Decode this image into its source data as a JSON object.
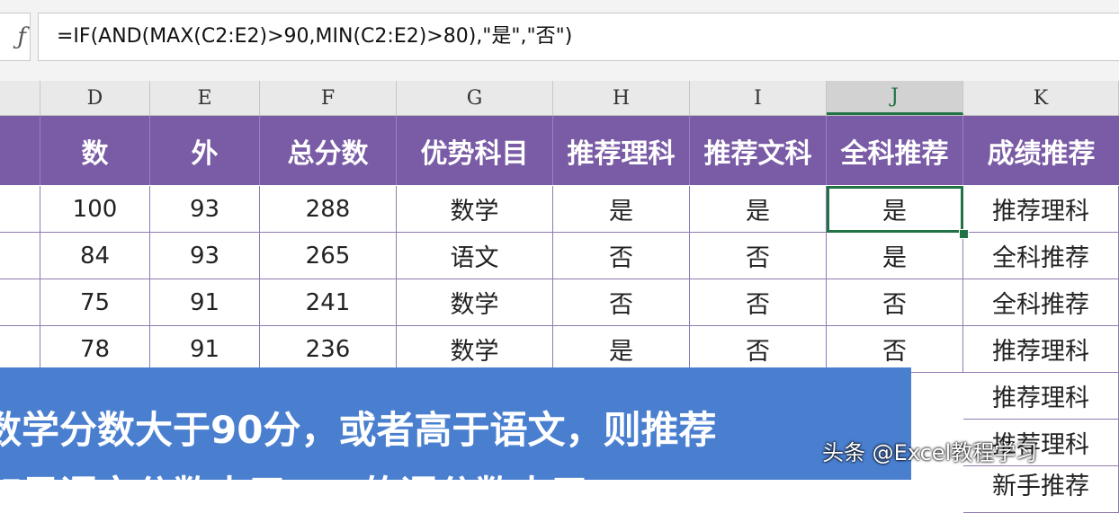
{
  "formula_bar": {
    "fx_label": "fx",
    "formula": "=IF(AND(MAX(C2:E2)>90,MIN(C2:E2)>80),\"是\",\"否\")"
  },
  "columns": [
    "D",
    "E",
    "F",
    "G",
    "H",
    "I",
    "J",
    "K"
  ],
  "active_column": "J",
  "table": {
    "headers": [
      "数",
      "外",
      "总分数",
      "优势科目",
      "推荐理科",
      "推荐文科",
      "全科推荐",
      "成绩推荐"
    ],
    "rows": [
      [
        "100",
        "93",
        "288",
        "数学",
        "是",
        "是",
        "是",
        "推荐理科"
      ],
      [
        "84",
        "93",
        "265",
        "语文",
        "否",
        "否",
        "是",
        "全科推荐"
      ],
      [
        "75",
        "91",
        "241",
        "数学",
        "否",
        "否",
        "否",
        "全科推荐"
      ],
      [
        "78",
        "91",
        "236",
        "数学",
        "是",
        "否",
        "否",
        "推荐理科"
      ],
      [
        "",
        "",
        "",
        "",
        "",
        "",
        "",
        "推荐理科"
      ],
      [
        "",
        "",
        "",
        "",
        "",
        "",
        "",
        "推荐理科"
      ],
      [
        "",
        "",
        "",
        "",
        "",
        "",
        "",
        "新手推荐"
      ]
    ]
  },
  "overlay": {
    "line1": "数学分数大于90分，或者高于语文，则推荐",
    "line2": "如果语文分数大于……的语分数大于"
  },
  "watermark": "头条 @Excel教程学习",
  "colors": {
    "header_bg": "#7a5ba6",
    "overlay_bg": "#4a7fd0",
    "selection": "#217346"
  }
}
